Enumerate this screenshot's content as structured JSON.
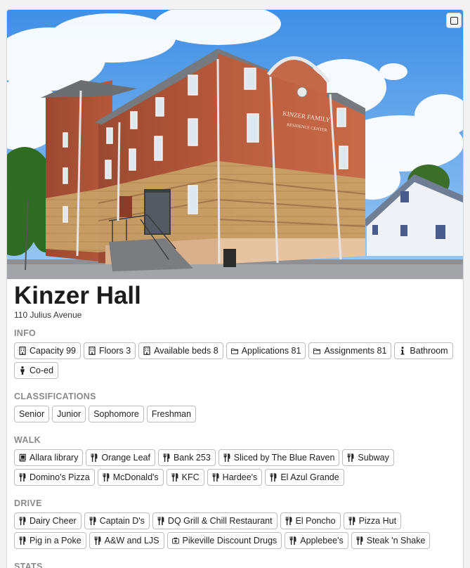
{
  "hall": {
    "name": "Kinzer Hall",
    "address": "110 Julius Avenue",
    "sign_line1": "KINZER FAMILY",
    "sign_line2": "RESIDENCE CENTER"
  },
  "sections": {
    "info": "INFO",
    "classifications": "CLASSIFICATIONS",
    "walk": "WALK",
    "drive": "DRIVE",
    "stats": "STATS"
  },
  "info": [
    {
      "icon": "building-icon",
      "label": "Capacity 99"
    },
    {
      "icon": "building-icon",
      "label": "Floors 3"
    },
    {
      "icon": "building-icon",
      "label": "Available beds 8"
    },
    {
      "icon": "folder-icon",
      "label": "Applications 81"
    },
    {
      "icon": "folder-icon",
      "label": "Assignments 81"
    },
    {
      "icon": "info-icon",
      "label": "Bathroom"
    },
    {
      "icon": "person-icon",
      "label": "Co-ed"
    }
  ],
  "classifications": [
    "Senior",
    "Junior",
    "Sophomore",
    "Freshman"
  ],
  "walk": [
    {
      "icon": "book-icon",
      "label": "Allara library"
    },
    {
      "icon": "utensils-icon",
      "label": "Orange Leaf"
    },
    {
      "icon": "utensils-icon",
      "label": "Bank 253"
    },
    {
      "icon": "utensils-icon",
      "label": "Sliced by The Blue Raven"
    },
    {
      "icon": "utensils-icon",
      "label": "Subway"
    },
    {
      "icon": "utensils-icon",
      "label": "Domino's Pizza"
    },
    {
      "icon": "utensils-icon",
      "label": "McDonald's"
    },
    {
      "icon": "utensils-icon",
      "label": "KFC"
    },
    {
      "icon": "utensils-icon",
      "label": "Hardee's"
    },
    {
      "icon": "utensils-icon",
      "label": "El Azul Grande"
    }
  ],
  "drive": [
    {
      "icon": "utensils-icon",
      "label": "Dairy Cheer"
    },
    {
      "icon": "utensils-icon",
      "label": "Captain D's"
    },
    {
      "icon": "utensils-icon",
      "label": "DQ Grill & Chill Restaurant"
    },
    {
      "icon": "utensils-icon",
      "label": "El Poncho"
    },
    {
      "icon": "utensils-icon",
      "label": "Pizza Hut"
    },
    {
      "icon": "utensils-icon",
      "label": "Pig in a Poke"
    },
    {
      "icon": "utensils-icon",
      "label": "A&W and LJS"
    },
    {
      "icon": "medkit-icon",
      "label": "Pikeville Discount Drugs"
    },
    {
      "icon": "utensils-icon",
      "label": "Applebee's"
    },
    {
      "icon": "utensils-icon",
      "label": "Steak 'n Shake"
    }
  ]
}
